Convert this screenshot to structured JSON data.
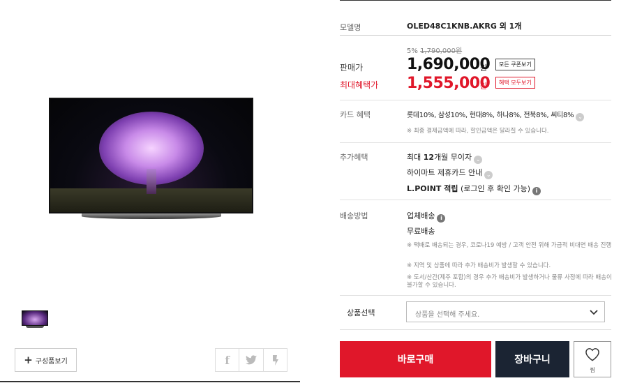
{
  "product": {
    "model_label": "모델명",
    "model_value": "OLED48C1KNB.AKRG 외 1개"
  },
  "price": {
    "discount_rate": "5%",
    "original_price": "1,790,000원",
    "sale_label": "판매가",
    "sale_price": "1,690,000",
    "won": "원",
    "coupon_button": "모든 쿠폰보기",
    "max_label": "최대혜택가",
    "max_price": "1,555,000",
    "benefit_button": "혜택 모두보기"
  },
  "card_benefit": {
    "label": "카드 혜택",
    "value": "롯데10%, 삼성10%, 현대8%, 하나8%, 전북8%, 씨티8%",
    "note": "※ 최종 결제금액에 따라, 할인금액은 달라질 수 있습니다."
  },
  "extra_benefit": {
    "label": "추가혜택",
    "installment_prefix": "최대 ",
    "installment_bold": "12",
    "installment_suffix": "개월 무이자",
    "himart_card": "하이마트 제휴카드 안내",
    "lpoint_bold": "L.POINT 적립",
    "lpoint_suffix": " (로그인 후 확인 가능)"
  },
  "shipping": {
    "label": "배송방법",
    "method": "업체배송",
    "fee": "무료배송",
    "notes": [
      "※ 택배로 배송되는 경우, 코로나19 예방 / 고객 안전 위해 가급적 비대면 배송 진행",
      "※ 지역 및 상품에 따라 추가 배송비가 발생할 수 있습니다.",
      "※ 도서/산간(제주 포함)의 경우 추가 배송비가 발생하거나 물류 사정에 따라 배송이 불가할 수 있습니다."
    ]
  },
  "option": {
    "label": "상품선택",
    "placeholder": "상품을 선택해 주세요."
  },
  "actions": {
    "buy": "바로구매",
    "cart": "장바구니",
    "wish": "찜"
  },
  "left": {
    "components_button": "구성품보기",
    "share": {
      "facebook": "f",
      "twitter": "t",
      "kakao": "k"
    }
  },
  "colors": {
    "accent_red": "#e0172a",
    "cart_navy": "#1b2433"
  }
}
